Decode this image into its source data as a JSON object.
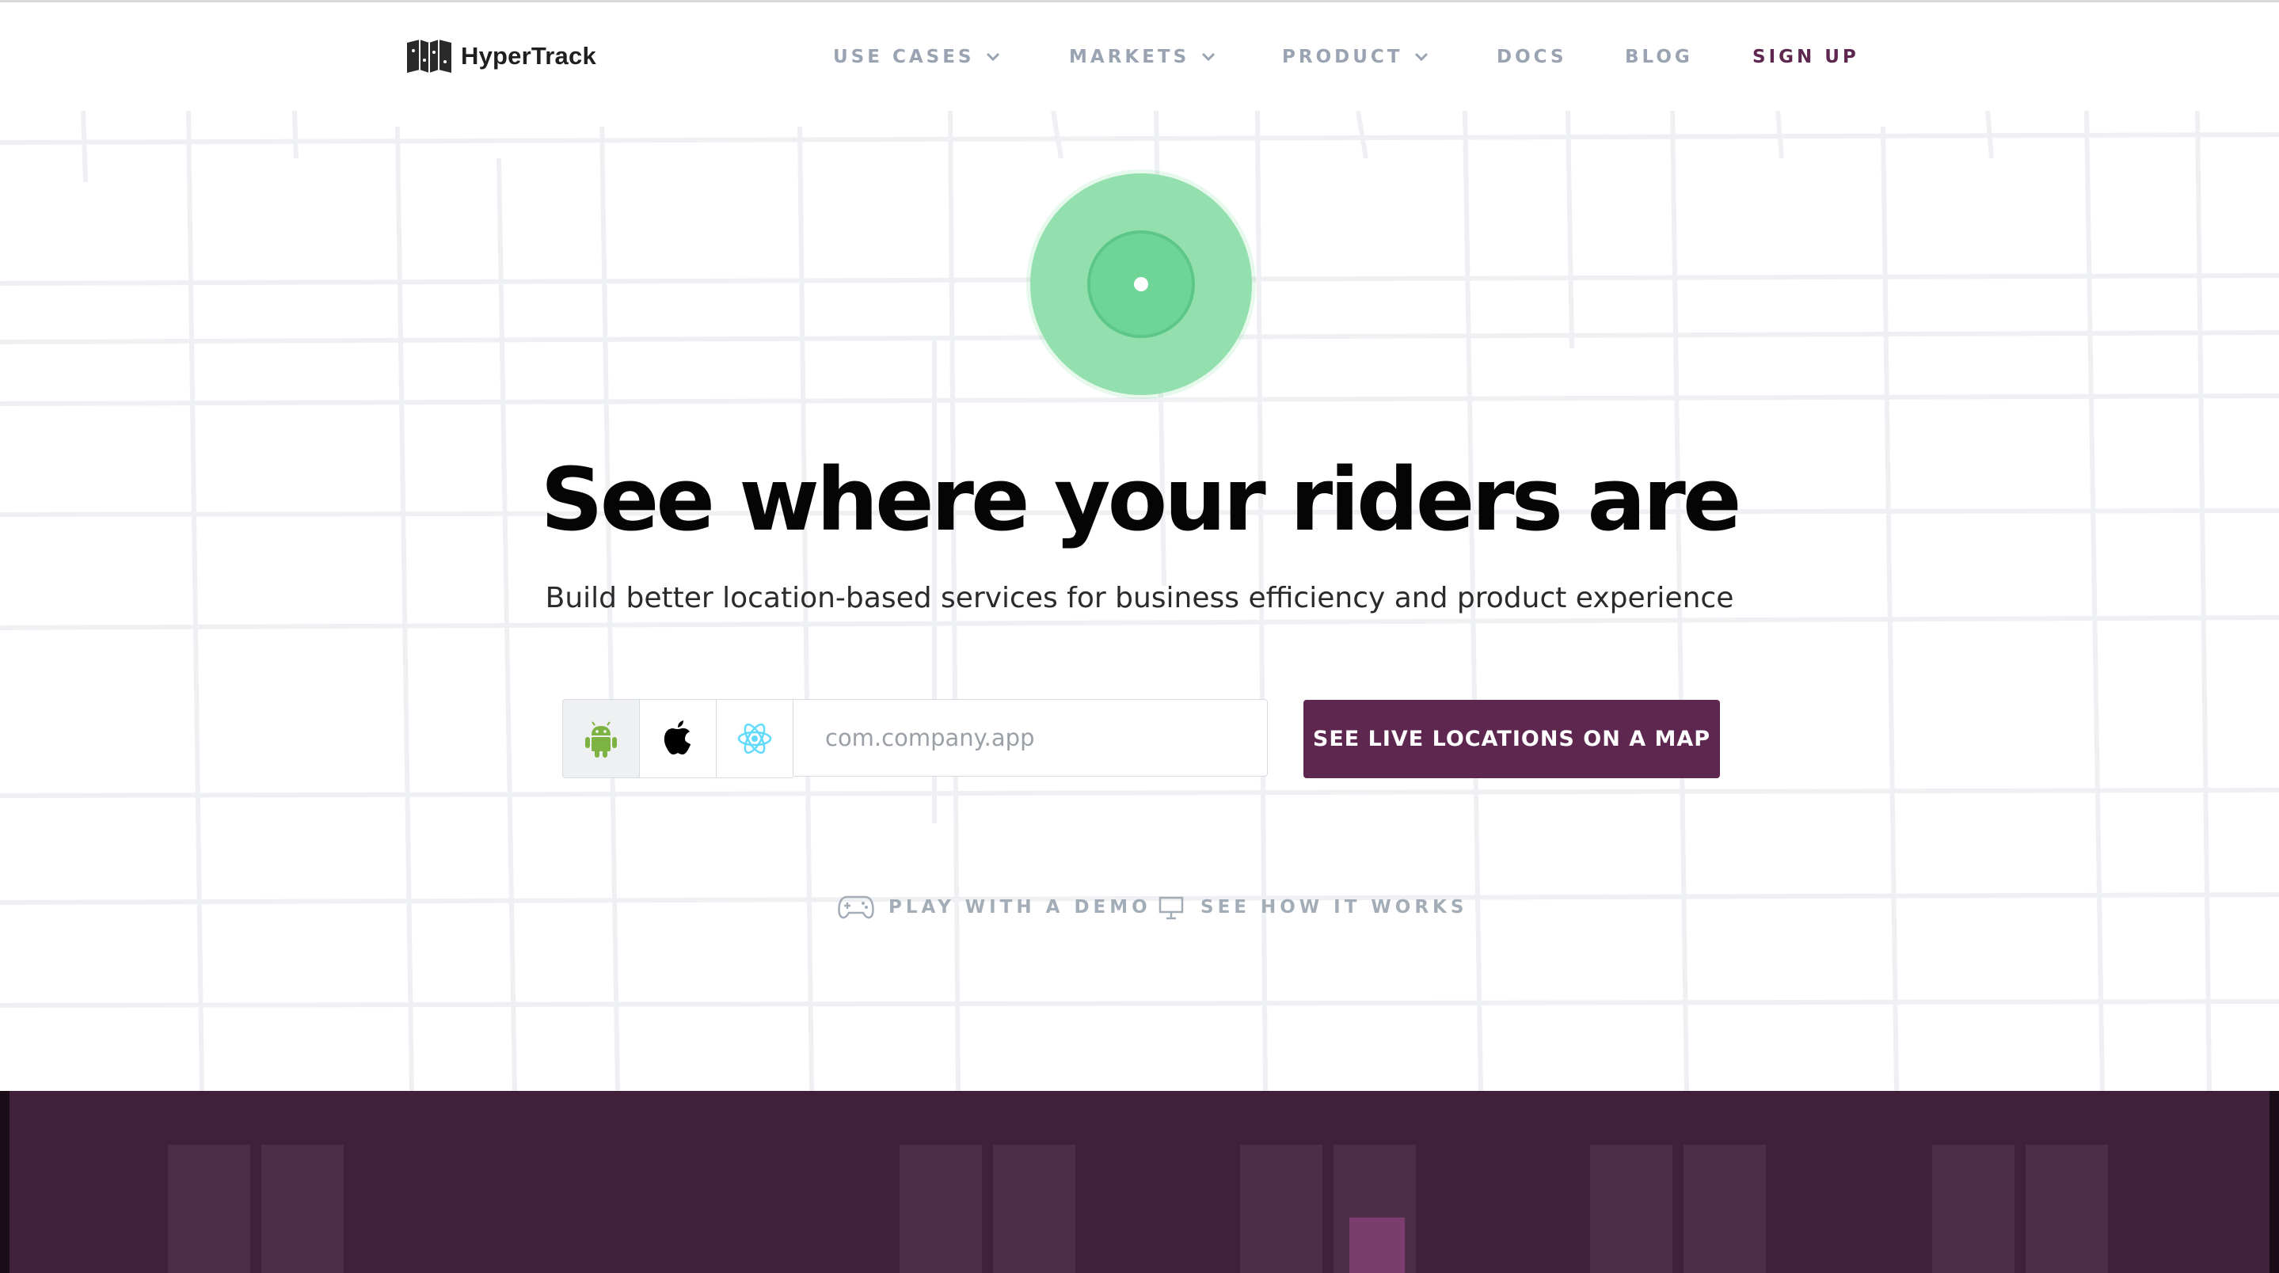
{
  "brand": {
    "name": "HyperTrack"
  },
  "nav": {
    "items": [
      {
        "label": "USE CASES",
        "dropdown": true
      },
      {
        "label": "MARKETS",
        "dropdown": true
      },
      {
        "label": "PRODUCT",
        "dropdown": true
      },
      {
        "label": "DOCS",
        "dropdown": false
      },
      {
        "label": "BLOG",
        "dropdown": false
      },
      {
        "label": "SIGN UP",
        "dropdown": false
      }
    ]
  },
  "hero": {
    "title": "See where your riders are",
    "subtitle": "Build better location-based services for business efficiency and product experience",
    "platforms": [
      {
        "icon": "android-icon",
        "selected": true
      },
      {
        "icon": "apple-icon",
        "selected": false
      },
      {
        "icon": "react-icon",
        "selected": false
      }
    ],
    "app_input": {
      "placeholder": "com.company.app",
      "value": ""
    },
    "cta_label": "SEE LIVE LOCATIONS ON A MAP"
  },
  "links": {
    "demo": {
      "label": "PLAY WITH A DEMO",
      "icon": "gamepad-icon"
    },
    "how": {
      "label": "SEE HOW IT WORKS",
      "icon": "presentation-icon"
    }
  },
  "colors": {
    "brand_purple": "#5e2750",
    "band": "#41203a",
    "pulse_green": "#5cd089",
    "nav_gray": "#9aa3b2"
  }
}
